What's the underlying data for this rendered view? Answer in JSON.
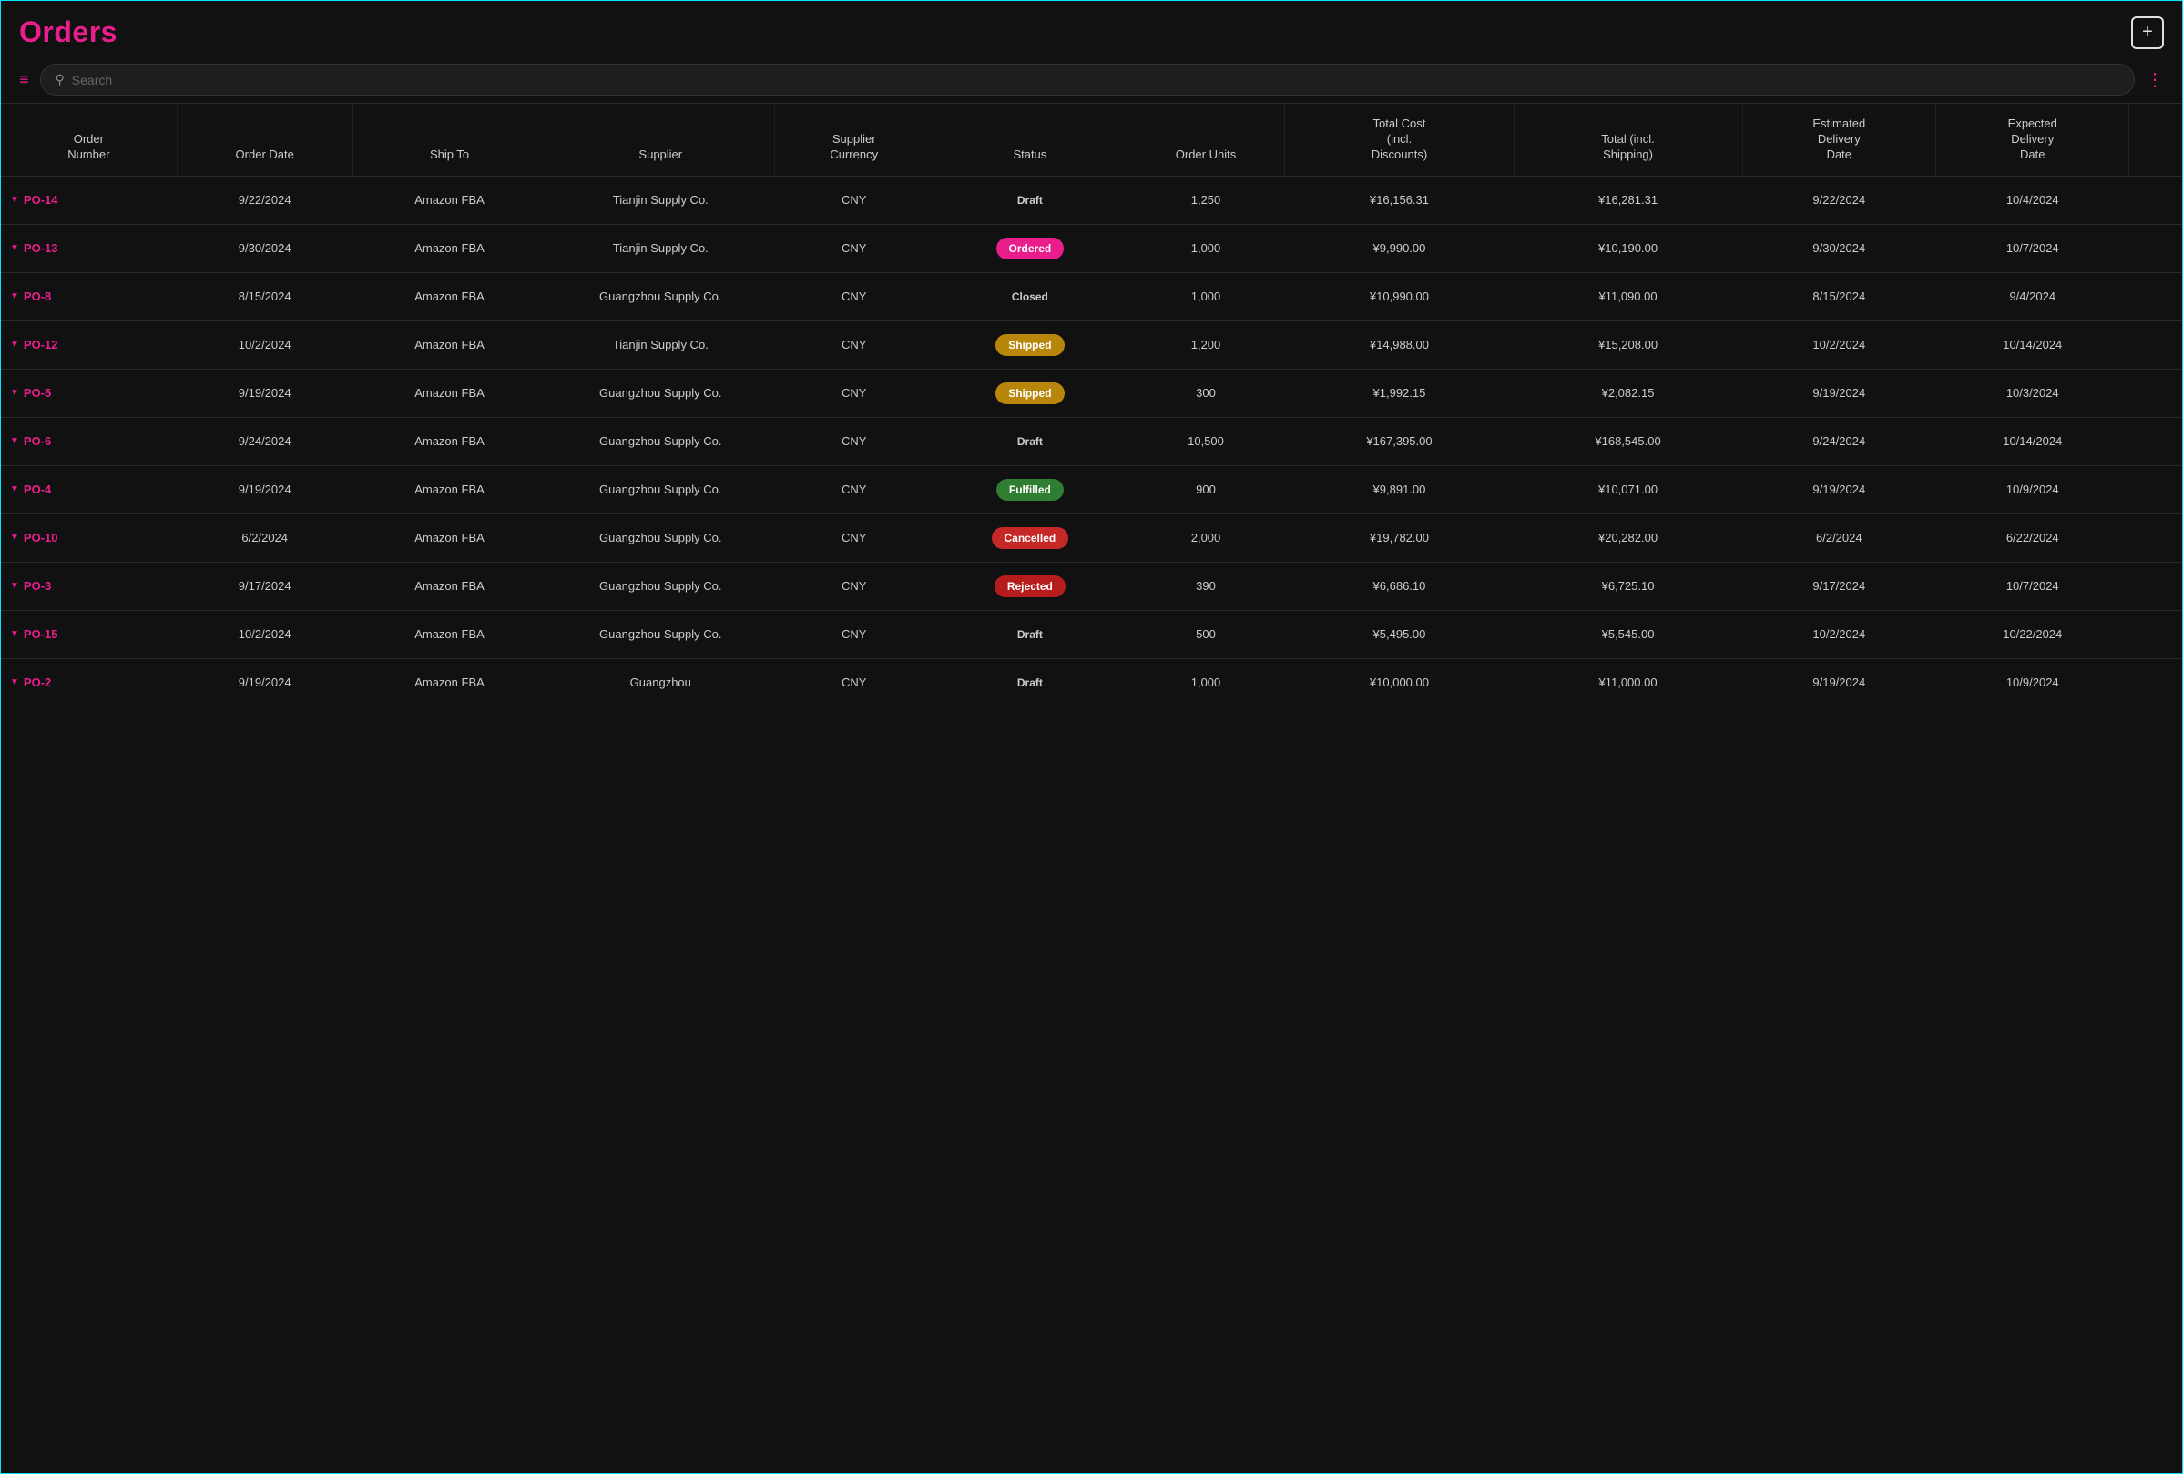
{
  "header": {
    "title": "Orders",
    "add_button_label": "+",
    "search_placeholder": "Search"
  },
  "toolbar": {
    "filter_icon": "≡",
    "more_icon": "⋮"
  },
  "table": {
    "columns": [
      "Order Number",
      "Order Date",
      "Ship To",
      "Supplier",
      "Supplier Currency",
      "Status",
      "Order Units",
      "Total Cost (incl. Discounts)",
      "Total (incl. Shipping)",
      "Estimated Delivery Date",
      "Expected Delivery Date",
      ""
    ],
    "rows": [
      {
        "id": "PO-14",
        "order_date": "9/22/2024",
        "ship_to": "Amazon FBA",
        "supplier": "Tianjin Supply Co.",
        "currency": "CNY",
        "status": "Draft",
        "status_type": "draft",
        "order_units": "1,250",
        "total_cost": "¥16,156.31",
        "total_incl_shipping": "¥16,281.31",
        "est_delivery": "9/22/2024",
        "exp_delivery": "10/4/2024"
      },
      {
        "id": "PO-13",
        "order_date": "9/30/2024",
        "ship_to": "Amazon FBA",
        "supplier": "Tianjin Supply Co.",
        "currency": "CNY",
        "status": "Ordered",
        "status_type": "ordered",
        "order_units": "1,000",
        "total_cost": "¥9,990.00",
        "total_incl_shipping": "¥10,190.00",
        "est_delivery": "9/30/2024",
        "exp_delivery": "10/7/2024"
      },
      {
        "id": "PO-8",
        "order_date": "8/15/2024",
        "ship_to": "Amazon FBA",
        "supplier": "Guangzhou Supply Co.",
        "currency": "CNY",
        "status": "Closed",
        "status_type": "closed",
        "order_units": "1,000",
        "total_cost": "¥10,990.00",
        "total_incl_shipping": "¥11,090.00",
        "est_delivery": "8/15/2024",
        "exp_delivery": "9/4/2024"
      },
      {
        "id": "PO-12",
        "order_date": "10/2/2024",
        "ship_to": "Amazon FBA",
        "supplier": "Tianjin Supply Co.",
        "currency": "CNY",
        "status": "Shipped",
        "status_type": "shipped",
        "order_units": "1,200",
        "total_cost": "¥14,988.00",
        "total_incl_shipping": "¥15,208.00",
        "est_delivery": "10/2/2024",
        "exp_delivery": "10/14/2024"
      },
      {
        "id": "PO-5",
        "order_date": "9/19/2024",
        "ship_to": "Amazon FBA",
        "supplier": "Guangzhou Supply Co.",
        "currency": "CNY",
        "status": "Shipped",
        "status_type": "shipped",
        "order_units": "300",
        "total_cost": "¥1,992.15",
        "total_incl_shipping": "¥2,082.15",
        "est_delivery": "9/19/2024",
        "exp_delivery": "10/3/2024"
      },
      {
        "id": "PO-6",
        "order_date": "9/24/2024",
        "ship_to": "Amazon FBA",
        "supplier": "Guangzhou Supply Co.",
        "currency": "CNY",
        "status": "Draft",
        "status_type": "draft",
        "order_units": "10,500",
        "total_cost": "¥167,395.00",
        "total_incl_shipping": "¥168,545.00",
        "est_delivery": "9/24/2024",
        "exp_delivery": "10/14/2024"
      },
      {
        "id": "PO-4",
        "order_date": "9/19/2024",
        "ship_to": "Amazon FBA",
        "supplier": "Guangzhou Supply Co.",
        "currency": "CNY",
        "status": "Fulfilled",
        "status_type": "fulfilled",
        "order_units": "900",
        "total_cost": "¥9,891.00",
        "total_incl_shipping": "¥10,071.00",
        "est_delivery": "9/19/2024",
        "exp_delivery": "10/9/2024"
      },
      {
        "id": "PO-10",
        "order_date": "6/2/2024",
        "ship_to": "Amazon FBA",
        "supplier": "Guangzhou Supply Co.",
        "currency": "CNY",
        "status": "Cancelled",
        "status_type": "cancelled",
        "order_units": "2,000",
        "total_cost": "¥19,782.00",
        "total_incl_shipping": "¥20,282.00",
        "est_delivery": "6/2/2024",
        "exp_delivery": "6/22/2024"
      },
      {
        "id": "PO-3",
        "order_date": "9/17/2024",
        "ship_to": "Amazon FBA",
        "supplier": "Guangzhou Supply Co.",
        "currency": "CNY",
        "status": "Rejected",
        "status_type": "rejected",
        "order_units": "390",
        "total_cost": "¥6,686.10",
        "total_incl_shipping": "¥6,725.10",
        "est_delivery": "9/17/2024",
        "exp_delivery": "10/7/2024"
      },
      {
        "id": "PO-15",
        "order_date": "10/2/2024",
        "ship_to": "Amazon FBA",
        "supplier": "Guangzhou Supply Co.",
        "currency": "CNY",
        "status": "Draft",
        "status_type": "draft",
        "order_units": "500",
        "total_cost": "¥5,495.00",
        "total_incl_shipping": "¥5,545.00",
        "est_delivery": "10/2/2024",
        "exp_delivery": "10/22/2024"
      },
      {
        "id": "PO-2",
        "order_date": "9/19/2024",
        "ship_to": "Amazon FBA",
        "supplier": "Guangzhou",
        "currency": "CNY",
        "status": "Draft",
        "status_type": "draft",
        "order_units": "1,000",
        "total_cost": "¥10,000.00",
        "total_incl_shipping": "¥11,000.00",
        "est_delivery": "9/19/2024",
        "exp_delivery": "10/9/2024"
      }
    ]
  }
}
